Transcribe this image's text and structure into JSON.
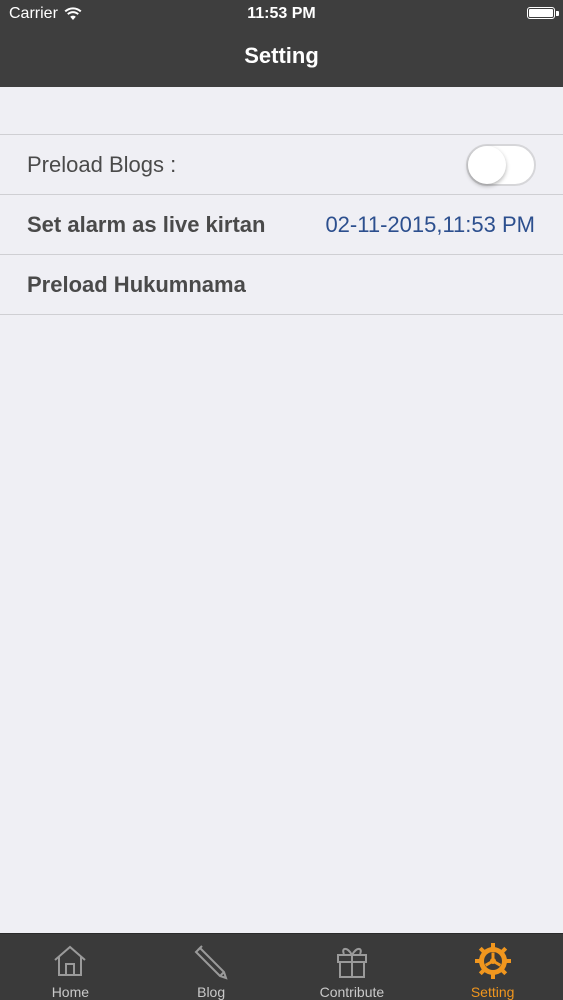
{
  "status_bar": {
    "carrier": "Carrier",
    "time": "11:53 PM",
    "wifi_icon": "wifi-icon",
    "battery_icon": "battery-icon"
  },
  "nav": {
    "title": "Setting"
  },
  "settings": {
    "rows": [
      {
        "label": "Preload Blogs :",
        "control": "toggle",
        "on": false
      },
      {
        "label": "Set alarm as live kirtan",
        "value": "02-11-2015,11:53 PM"
      },
      {
        "label": "Preload Hukumnama"
      }
    ]
  },
  "tabbar": {
    "tabs": [
      {
        "label": "Home",
        "icon": "home-icon",
        "active": false
      },
      {
        "label": "Blog",
        "icon": "pencil-icon",
        "active": false
      },
      {
        "label": "Contribute",
        "icon": "gift-icon",
        "active": false
      },
      {
        "label": "Setting",
        "icon": "gear-icon",
        "active": true
      }
    ]
  },
  "colors": {
    "header_bg": "#3e3e3e",
    "tab_active": "#f0961e",
    "value_blue": "#2c4f8e",
    "background": "#efeff4"
  }
}
